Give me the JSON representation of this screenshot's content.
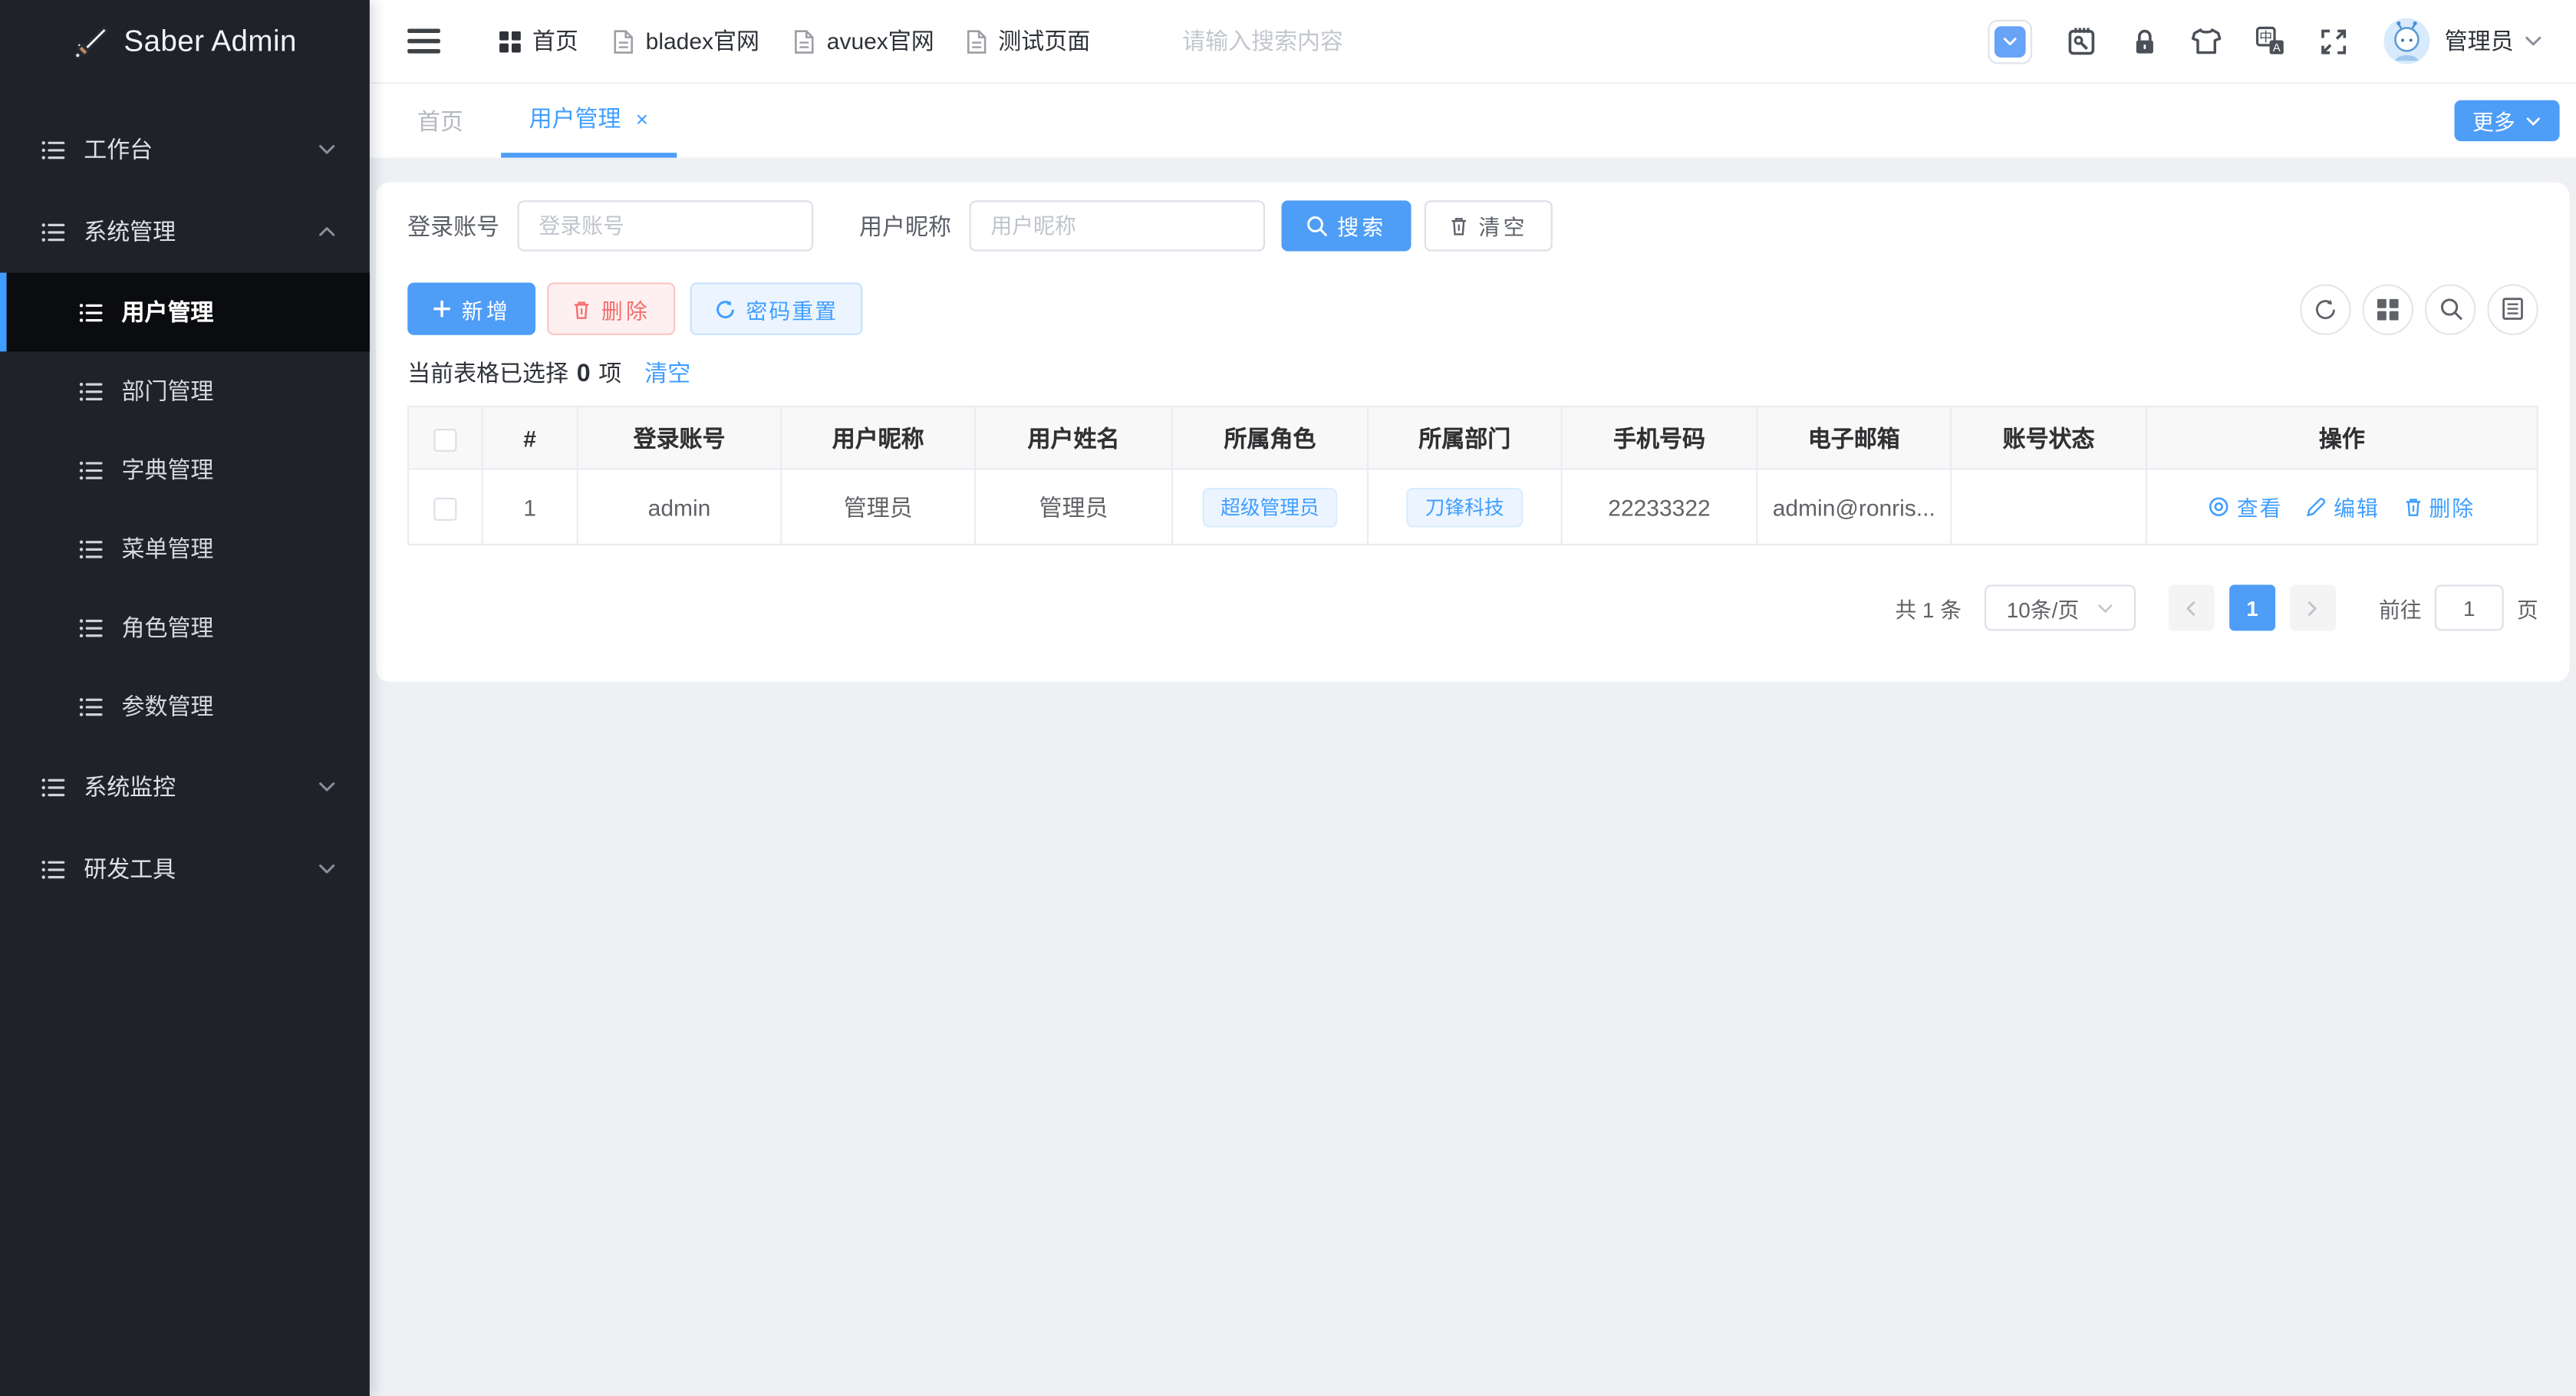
{
  "app": {
    "logo_text": "Saber Admin"
  },
  "colors": {
    "primary": "#409eff",
    "primary_button": "#4e9df6",
    "danger": "#f56c6c",
    "sidebar_bg": "#20222a",
    "sidebar_active_bg": "#0b0c10",
    "page_bg": "#eef0f4",
    "tag_bg": "#ecf5ff"
  },
  "sidebar": {
    "items": [
      {
        "label": "工作台"
      },
      {
        "label": "系统管理"
      },
      {
        "label": "用户管理"
      },
      {
        "label": "部门管理"
      },
      {
        "label": "字典管理"
      },
      {
        "label": "菜单管理"
      },
      {
        "label": "角色管理"
      },
      {
        "label": "参数管理"
      },
      {
        "label": "系统监控"
      },
      {
        "label": "研发工具"
      }
    ]
  },
  "header": {
    "nav": [
      {
        "label": "首页",
        "icon": "grid-icon"
      },
      {
        "label": "bladex官网",
        "icon": "document-icon"
      },
      {
        "label": "avuex官网",
        "icon": "document-icon"
      },
      {
        "label": "测试页面",
        "icon": "document-icon"
      }
    ],
    "search_placeholder": "请输入搜索内容",
    "user": {
      "name": "管理员"
    }
  },
  "tabs": {
    "items": [
      {
        "label": "首页"
      },
      {
        "label": "用户管理",
        "close": "×"
      }
    ],
    "more_label": "更多"
  },
  "filters": {
    "account_label": "登录账号",
    "account_placeholder": "登录账号",
    "nickname_label": "用户昵称",
    "nickname_placeholder": "用户昵称",
    "search_label": "搜索",
    "clear_label": "清空"
  },
  "toolbar": {
    "add_label": "新增",
    "delete_label": "删除",
    "reset_label": "密码重置"
  },
  "selection": {
    "text_before": "当前表格已选择",
    "count": "0",
    "text_after": "项",
    "clear_label": "清空"
  },
  "table": {
    "columns": [
      "#",
      "登录账号",
      "用户昵称",
      "用户姓名",
      "所属角色",
      "所属部门",
      "手机号码",
      "电子邮箱",
      "账号状态",
      "操作"
    ],
    "rows": [
      {
        "index": "1",
        "account": "admin",
        "nickname": "管理员",
        "name": "管理员",
        "role": "超级管理员",
        "dept": "刀锋科技",
        "phone": "22233322",
        "email": "admin@ronris...",
        "status": "",
        "view": "查看",
        "edit": "编辑",
        "del": "删除"
      }
    ]
  },
  "pagination": {
    "total": "共 1 条",
    "page_size": "10条/页",
    "page": "1",
    "goto_label": "前往",
    "goto_value": "1",
    "unit_label": "页"
  }
}
